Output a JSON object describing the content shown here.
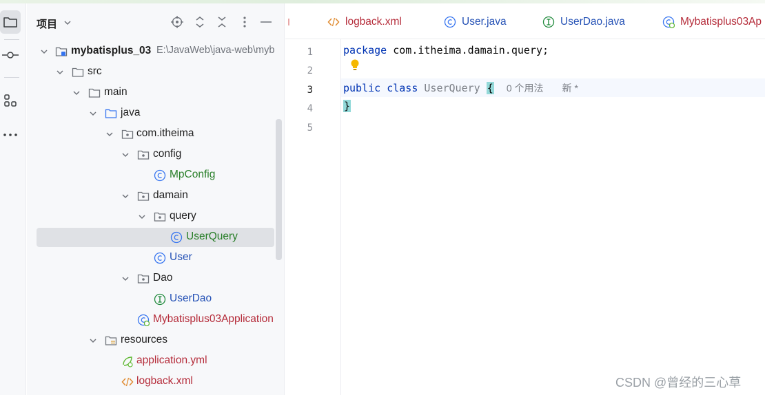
{
  "toolstrip": {
    "icons": [
      "folder-icon",
      "commit-icon",
      "structure-icon",
      "more-icon"
    ]
  },
  "panel": {
    "title": "项目",
    "header_icons": [
      "locate-icon",
      "expand-all-icon",
      "collapse-all-icon",
      "more-options-icon",
      "minimize-icon"
    ]
  },
  "tree": [
    {
      "label": "mybatisplus_03",
      "path": "E:\\JavaWeb\\java-web\\myb"
    },
    {
      "label": "src"
    },
    {
      "label": "main"
    },
    {
      "label": "java"
    },
    {
      "label": "com.itheima"
    },
    {
      "label": "config"
    },
    {
      "label": "MpConfig"
    },
    {
      "label": "damain"
    },
    {
      "label": "query"
    },
    {
      "label": "UserQuery"
    },
    {
      "label": "User"
    },
    {
      "label": "Dao"
    },
    {
      "label": "UserDao"
    },
    {
      "label": "Mybatisplus03Application"
    },
    {
      "label": "resources"
    },
    {
      "label": "application.yml"
    },
    {
      "label": "logback.xml"
    }
  ],
  "tabs": [
    {
      "label": "logback.xml"
    },
    {
      "label": "User.java"
    },
    {
      "label": "UserDao.java"
    },
    {
      "label": "Mybatisplus03Ap"
    }
  ],
  "editor": {
    "line_numbers": [
      "1",
      "2",
      "3",
      "4",
      "5"
    ],
    "line1": {
      "keyword": "package",
      "name": "com.itheima.damain.query;"
    },
    "line3": {
      "kw1": "public",
      "kw2": "class",
      "classname": "UserQuery",
      "brace_open": "{",
      "hint_usages": "0 个用法",
      "hint_new": "新 *"
    },
    "line4": {
      "brace_close": "}"
    }
  },
  "colors": {
    "accent_green": "#287e28",
    "accent_blue": "#2350b5",
    "accent_red": "#b52c3a",
    "brace_highlight": "#93d9d9",
    "selection": "#dfe1e5"
  },
  "watermark": "CSDN @曾经的三心草"
}
